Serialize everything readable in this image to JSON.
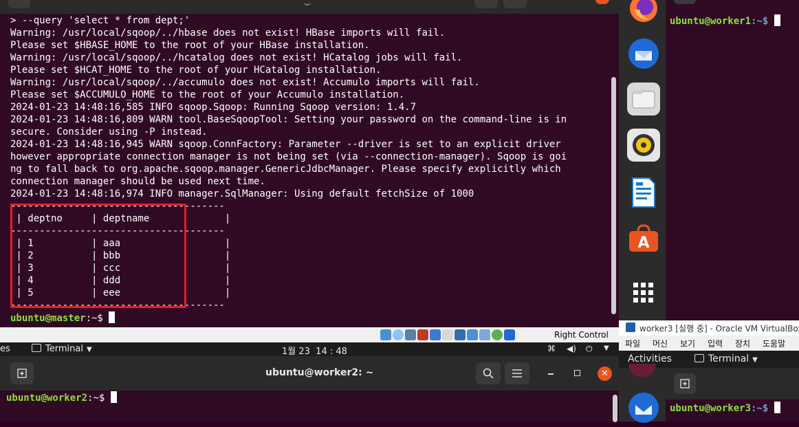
{
  "master": {
    "lines": [
      "> --query 'select * from dept;'",
      "Warning: /usr/local/sqoop/../hbase does not exist! HBase imports will fail.",
      "Please set $HBASE_HOME to the root of your HBase installation.",
      "Warning: /usr/local/sqoop/../hcatalog does not exist! HCatalog jobs will fail.",
      "Please set $HCAT_HOME to the root of your HCatalog installation.",
      "Warning: /usr/local/sqoop/../accumulo does not exist! Accumulo imports will fail.",
      "Please set $ACCUMULO_HOME to the root of your Accumulo installation.",
      "2024-01-23 14:48:16,585 INFO sqoop.Sqoop: Running Sqoop version: 1.4.7",
      "2024-01-23 14:48:16,809 WARN tool.BaseSqoopTool: Setting your password on the command-line is in",
      "secure. Consider using -P instead.",
      "2024-01-23 14:48:16,945 WARN sqoop.ConnFactory: Parameter --driver is set to an explicit driver",
      "however appropriate connection manager is not being set (via --connection-manager). Sqoop is goi",
      "ng to fall back to org.apache.sqoop.manager.GenericJdbcManager. Please specify explicitly which",
      "connection manager should be used next time.",
      "2024-01-23 14:48:16,974 INFO manager.SqlManager: Using default fetchSize of 1000"
    ],
    "table_border": "-------------------------------------",
    "table_header": " | deptno     | deptname             | ",
    "table_header_cells": [
      "deptno",
      "deptname"
    ],
    "table_rows": [
      [
        "1",
        "aaa"
      ],
      [
        "2",
        "bbb"
      ],
      [
        "3",
        "ccc"
      ],
      [
        "4",
        "ddd"
      ],
      [
        "5",
        "eee"
      ]
    ],
    "prompt_user": "ubuntu@master",
    "prompt_path": ":~$ "
  },
  "worker1": {
    "prompt_user": "ubuntu@worker1",
    "prompt_path": ":~$ "
  },
  "worker2": {
    "title": "ubuntu@worker2: ~",
    "prompt_user": "ubuntu@worker2",
    "prompt_path": ":~$ "
  },
  "worker3": {
    "window_title": "worker3 [실행 중] - Oracle VM VirtualBox",
    "menu": [
      "파일",
      "머신",
      "보기",
      "입력",
      "장치",
      "도움말"
    ],
    "activities": "Activities",
    "app_label": "Terminal",
    "prompt_user": "ubuntu@worker3",
    "prompt_path": ":~$ "
  },
  "vbox_status": {
    "host_key": "Right Control"
  },
  "topbar": {
    "left_fragment": "es",
    "app_label": "Terminal",
    "clock": "1월 23  14 : 48"
  },
  "colors": {
    "term_bg": "#300a24",
    "prompt_green": "#8ae234",
    "prompt_blue": "#729fcf",
    "highlight_red": "#e0202a"
  }
}
